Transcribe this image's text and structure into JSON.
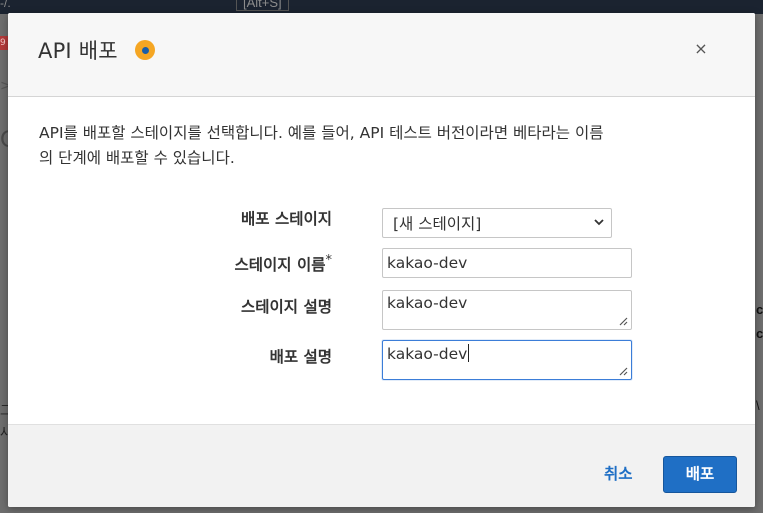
{
  "background": {
    "shortcut": "[Alt+S]",
    "shortcut_left": "-/.",
    "badge": "9",
    "chevron": ">",
    "heading_fragment": "C",
    "right_fragment_1": "c",
    "right_fragment_2": "c",
    "left_fragment_1": "그",
    "left_fragment_2": "사",
    "right_fragment_3": "\\"
  },
  "modal": {
    "title": "API 배포",
    "info_icon": "info-icon",
    "close_label": "×",
    "description": "API를 배포할 스테이지를 선택합니다. 예를 들어, API 테스트 버전이라면 베타라는 이름의 단계에 배포할 수 있습니다.",
    "description_line1": "API를 배포할 스테이지를 선택합니다. 예를 들어, API 테스트 버전이라면 베타라는 이름",
    "description_line2": "의 단계에 배포할 수 있습니다.",
    "form": {
      "deploy_stage_label": "배포 스테이지",
      "deploy_stage_value": "[새 스테이지]",
      "stage_name_label": "스테이지 이름",
      "stage_name_required": "*",
      "stage_name_value": "kakao-dev",
      "stage_description_label": "스테이지 설명",
      "stage_description_value": "kakao-dev",
      "deployment_description_label": "배포 설명",
      "deployment_description_value": "kakao-dev"
    },
    "footer": {
      "cancel_label": "취소",
      "deploy_label": "배포"
    }
  },
  "colors": {
    "accent": "#1f6fc5",
    "info": "#f5a623",
    "focus": "#3b7dd8"
  }
}
